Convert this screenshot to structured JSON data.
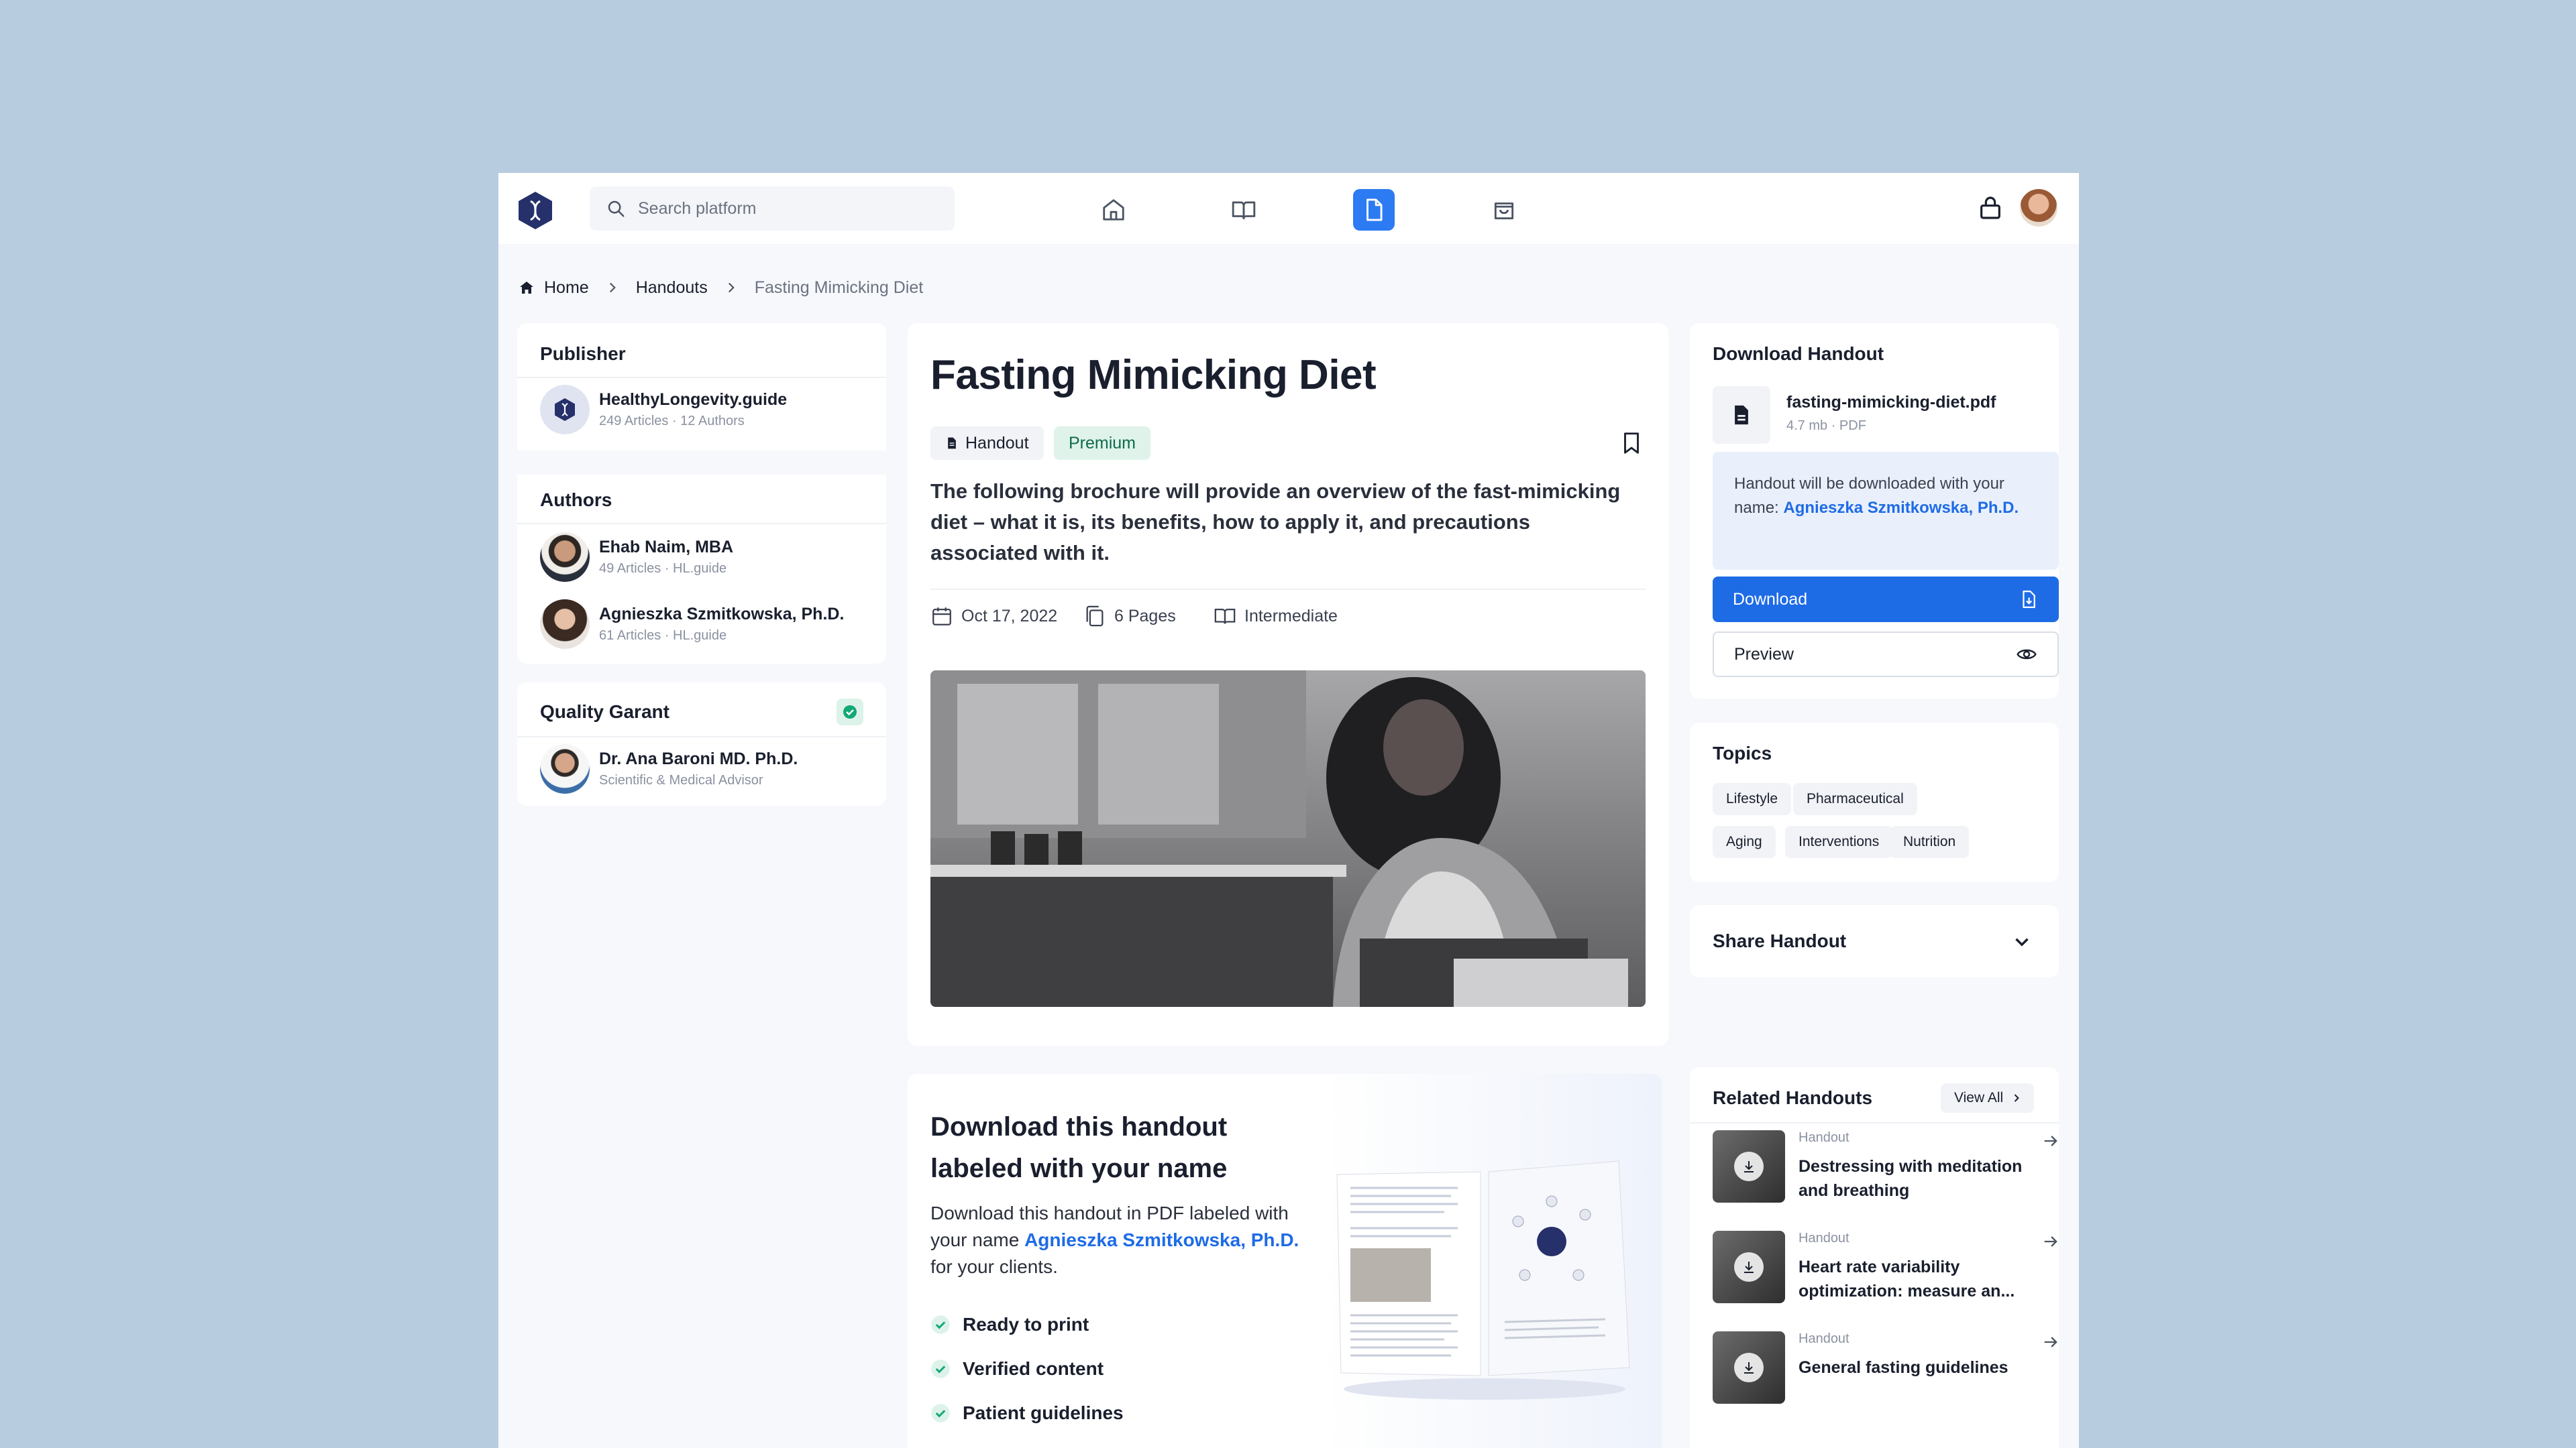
{
  "header": {
    "search_placeholder": "Search platform",
    "nav": [
      "home-icon",
      "book-icon",
      "document-icon",
      "bag-icon"
    ],
    "accent": "#2c7bf2"
  },
  "breadcrumb": [
    "Home",
    "Handouts",
    "Fasting Mimicking Diet"
  ],
  "publisher": {
    "heading": "Publisher",
    "name": "HealthyLongevity.guide",
    "stats": "249 Articles · 12 Authors"
  },
  "authors": {
    "heading": "Authors",
    "items": [
      {
        "name": "Ehab Naim, MBA",
        "stats": "49 Articles · HL.guide"
      },
      {
        "name": "Agnieszka Szmitkowska, Ph.D.",
        "stats": "61 Articles · HL.guide"
      }
    ]
  },
  "quality": {
    "heading": "Quality Garant",
    "name": "Dr. Ana Baroni MD. Ph.D.",
    "role": "Scientific & Medical Advisor"
  },
  "article": {
    "title": "Fasting Mimicking Diet",
    "tags": [
      "Handout",
      "Premium"
    ],
    "intro": "The following brochure will provide an overview of the fast-mimicking diet – what it is, its benefits, how to apply it, and precautions associated with it.",
    "date": "Oct 17, 2022",
    "pages": "6 Pages",
    "level": "Intermediate"
  },
  "promo": {
    "title": "Download this handout labeled with your name",
    "text_before": "Download this handout in PDF labeled with your name ",
    "name": "Agnieszka Szmitkowska, Ph.D.",
    "text_after": " for your clients.",
    "checks": [
      "Ready to print",
      "Verified content",
      "Patient guidelines"
    ]
  },
  "download": {
    "heading": "Download Handout",
    "file_name": "fasting-mimicking-diet.pdf",
    "file_meta": "4.7 mb · PDF",
    "notice_before": "Handout will be downloaded with your name: ",
    "notice_name": "Agnieszka Szmitkowska, Ph.D.",
    "download_label": "Download",
    "preview_label": "Preview"
  },
  "topics": {
    "heading": "Topics",
    "items": [
      "Lifestyle",
      "Pharmaceutical",
      "Aging",
      "Interventions",
      "Nutrition"
    ]
  },
  "share": {
    "heading": "Share Handout"
  },
  "related": {
    "heading": "Related Handouts",
    "view_all": "View All",
    "items": [
      {
        "kind": "Handout",
        "title": "Destressing with meditation and breathing"
      },
      {
        "kind": "Handout",
        "title": "Heart rate variability optimization: measure an..."
      },
      {
        "kind": "Handout",
        "title": "General fasting guidelines"
      }
    ]
  }
}
